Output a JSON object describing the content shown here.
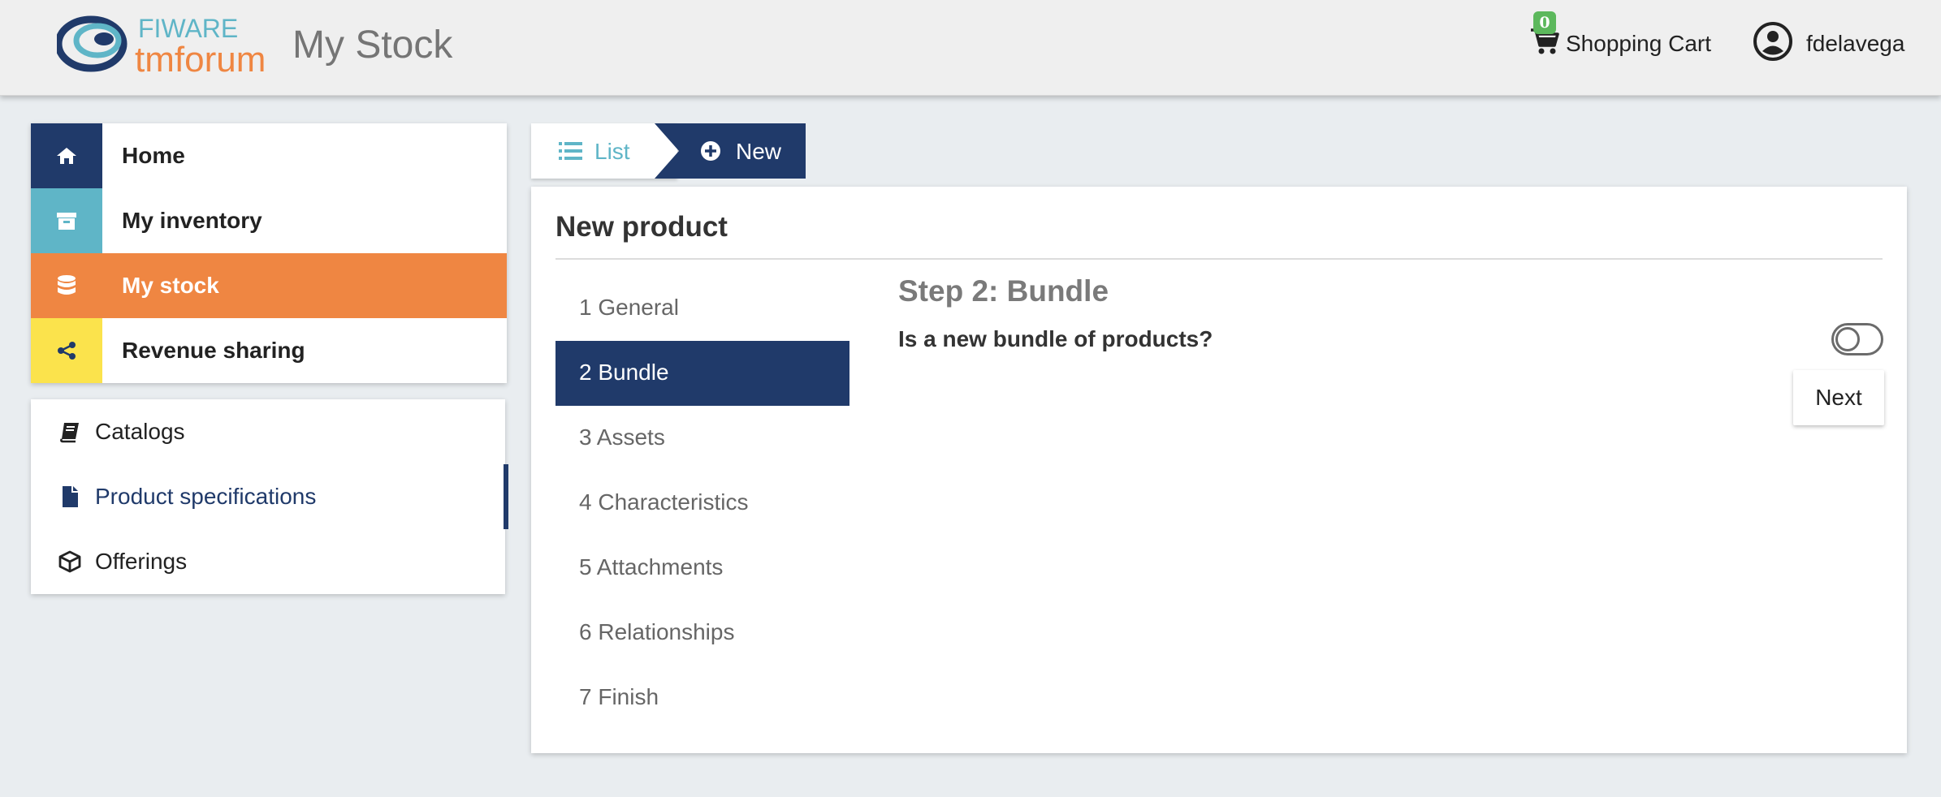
{
  "header": {
    "logo_text_top": "FIWARE",
    "logo_text_bottom": "tmforum",
    "app_title": "My Stock",
    "cart": {
      "badge_count": "0",
      "label": "Shopping Cart"
    },
    "user": {
      "name": "fdelavega"
    }
  },
  "main_nav": {
    "items": [
      {
        "label": "Home",
        "icon": "home-icon"
      },
      {
        "label": "My inventory",
        "icon": "archive-icon"
      },
      {
        "label": "My stock",
        "icon": "database-icon",
        "active": true
      },
      {
        "label": "Revenue sharing",
        "icon": "share-icon"
      }
    ]
  },
  "sub_nav": {
    "items": [
      {
        "label": "Catalogs",
        "icon": "book-icon"
      },
      {
        "label": "Product specifications",
        "icon": "file-icon",
        "active": true
      },
      {
        "label": "Offerings",
        "icon": "cube-icon"
      }
    ]
  },
  "tabs": {
    "list_label": "List",
    "new_label": "New"
  },
  "card": {
    "title": "New product",
    "steps": [
      "1 General",
      "2 Bundle",
      "3 Assets",
      "4 Characteristics",
      "5 Attachments",
      "6 Relationships",
      "7 Finish"
    ],
    "active_step_index": 1,
    "step_heading": "Step 2: Bundle",
    "question": "Is a new bundle of products?",
    "toggle_on": false,
    "next_label": "Next"
  },
  "colors": {
    "navy": "#203a6a",
    "teal": "#5fb5c7",
    "orange": "#ef8642",
    "yellow": "#fbe34c",
    "badge_green": "#5cb85c"
  }
}
